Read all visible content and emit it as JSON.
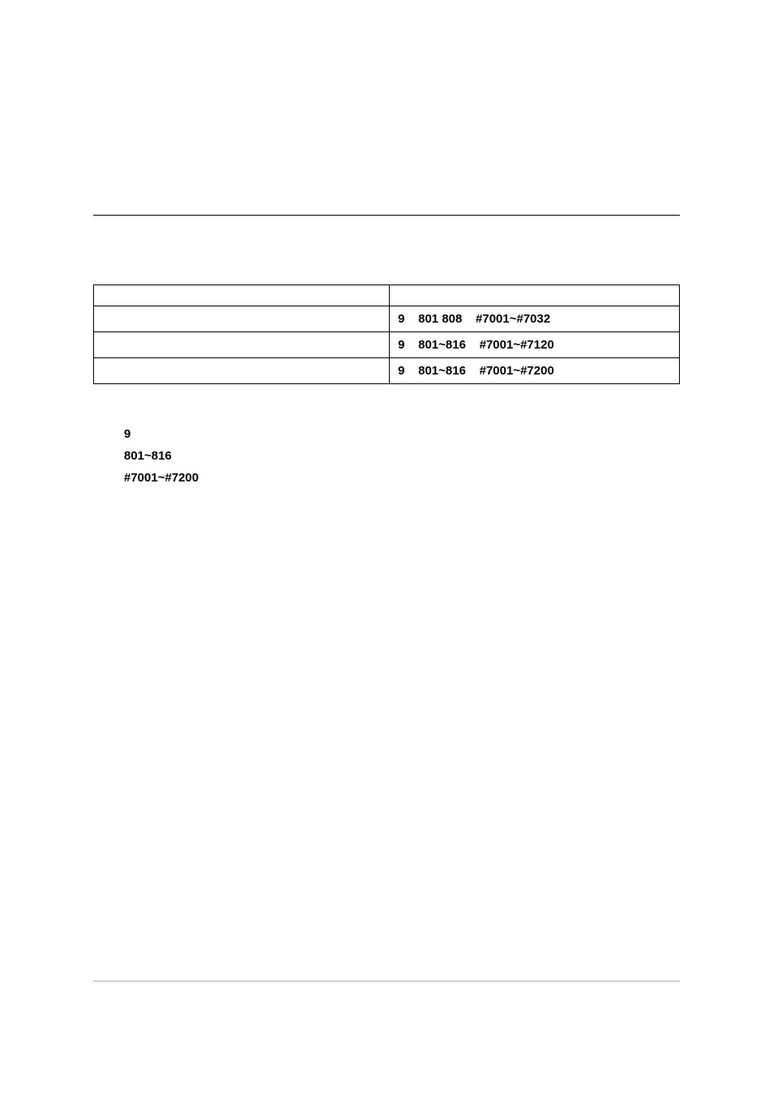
{
  "table": {
    "rows": [
      {
        "left": "",
        "right": ""
      },
      {
        "left": "",
        "right": "9    801 808    #7001~#7032"
      },
      {
        "left": "",
        "right": "9    801~816    #7001~#7120"
      },
      {
        "left": "",
        "right": "9    801~816    #7001~#7200"
      }
    ]
  },
  "list": {
    "line1": "9",
    "line2": "801~816",
    "line3": "#7001~#7200"
  }
}
